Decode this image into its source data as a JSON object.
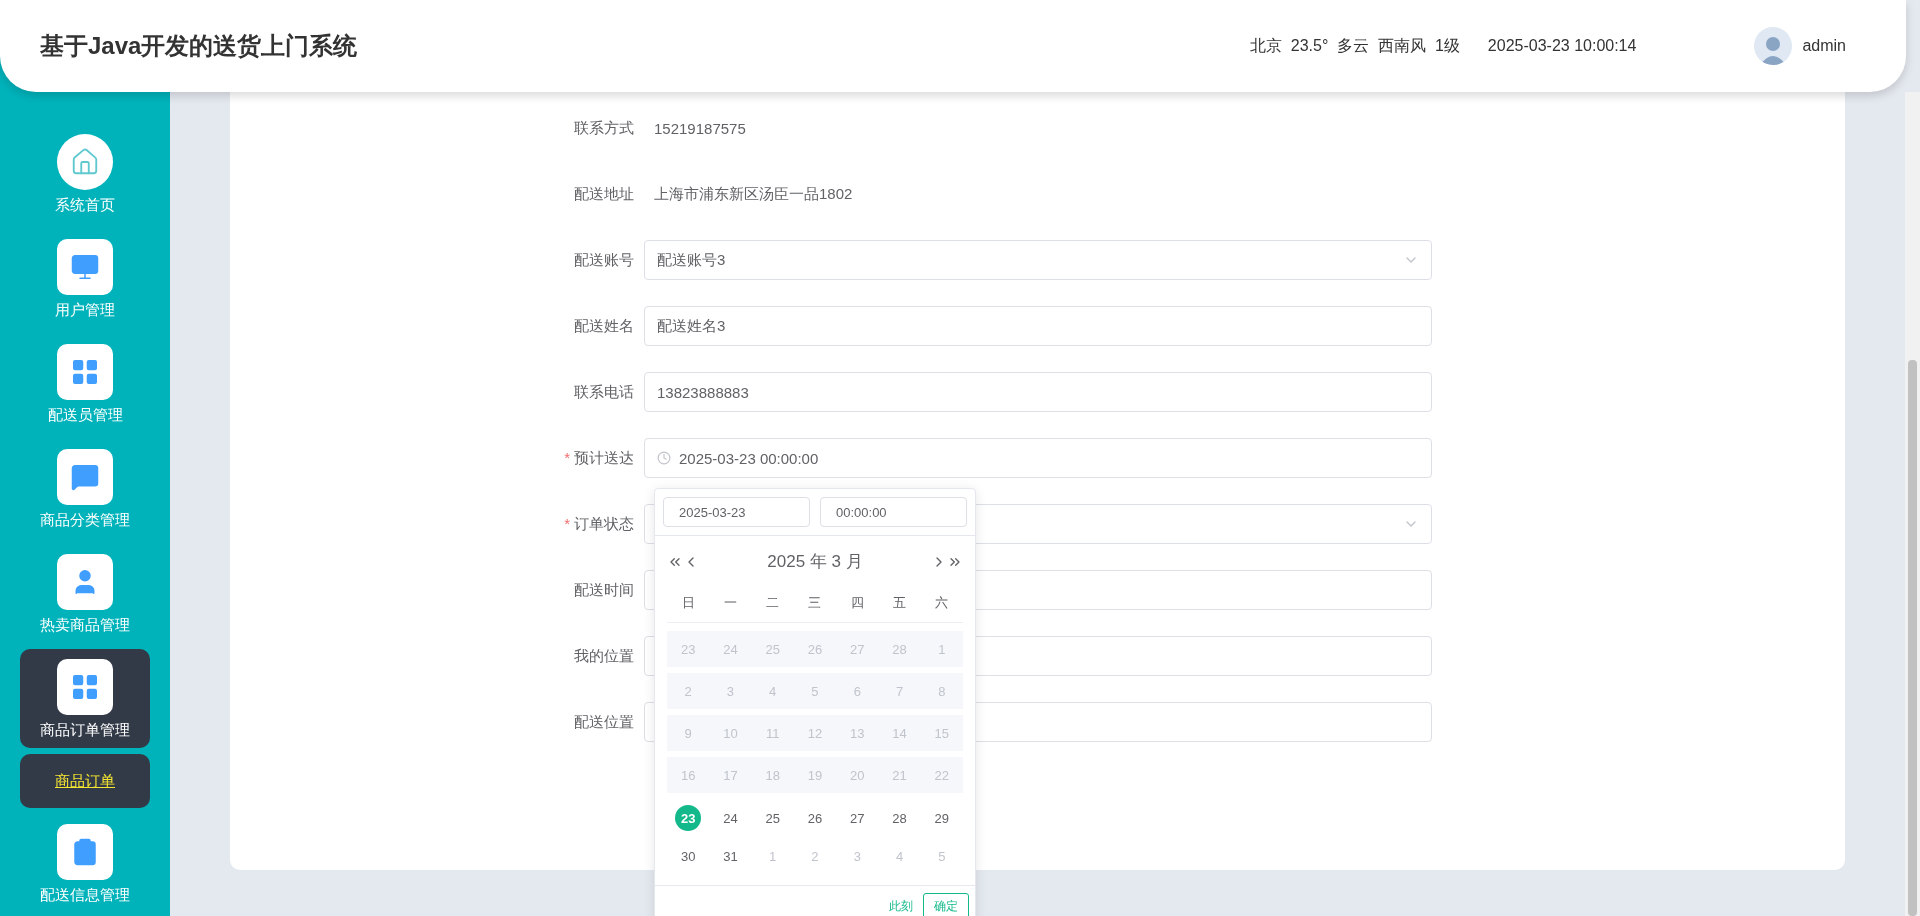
{
  "header": {
    "title": "基于Java开发的送货上门系统",
    "weather": "北京  23.5°  多云  西南风  1级",
    "time": "2025-03-23 10:00:14",
    "user": "admin"
  },
  "sidebar": {
    "items": [
      {
        "label": "系统首页",
        "selected": false
      },
      {
        "label": "用户管理",
        "selected": false
      },
      {
        "label": "配送员管理",
        "selected": false
      },
      {
        "label": "商品分类管理",
        "selected": false
      },
      {
        "label": "热卖商品管理",
        "selected": false
      },
      {
        "label": "商品订单管理",
        "selected": true,
        "children": [
          {
            "label": "商品订单",
            "selected": true
          }
        ]
      },
      {
        "label": "配送信息管理",
        "selected": false
      }
    ]
  },
  "form": {
    "fields": [
      {
        "label": "联系方式",
        "kind": "text",
        "value": "15219187575"
      },
      {
        "label": "配送地址",
        "kind": "text",
        "value": "上海市浦东新区汤臣一品1802"
      },
      {
        "label": "配送账号",
        "kind": "select",
        "value": "配送账号3"
      },
      {
        "label": "配送姓名",
        "kind": "input",
        "value": "配送姓名3"
      },
      {
        "label": "联系电话",
        "kind": "input",
        "value": "13823888883"
      },
      {
        "label": "预计送达",
        "required_mark": "*",
        "kind": "date",
        "value": "2025-03-23 00:00:00"
      },
      {
        "label": "订单状态",
        "required_mark": "*",
        "kind": "select"
      },
      {
        "label": "配送时间",
        "kind": "input"
      },
      {
        "label": "我的位置",
        "kind": "input"
      },
      {
        "label": "配送位置",
        "kind": "input"
      }
    ]
  },
  "date_picker": {
    "date_value": "2025-03-23",
    "time_value": "00:00:00",
    "title": "2025 年  3 月",
    "weekdays": [
      "日",
      "一",
      "二",
      "三",
      "四",
      "五",
      "六"
    ],
    "weeks": [
      [
        {
          "day": "23",
          "kind": "disabled",
          "selected": false
        },
        {
          "day": "24",
          "kind": "disabled",
          "selected": false
        },
        {
          "day": "25",
          "kind": "disabled",
          "selected": false
        },
        {
          "day": "26",
          "kind": "disabled",
          "selected": false
        },
        {
          "day": "27",
          "kind": "disabled",
          "selected": false
        },
        {
          "day": "28",
          "kind": "disabled",
          "selected": false
        },
        {
          "day": "1",
          "kind": "disabled",
          "selected": false
        }
      ],
      [
        {
          "day": "2",
          "kind": "disabled",
          "selected": false
        },
        {
          "day": "3",
          "kind": "disabled",
          "selected": false
        },
        {
          "day": "4",
          "kind": "disabled",
          "selected": false
        },
        {
          "day": "5",
          "kind": "disabled",
          "selected": false
        },
        {
          "day": "6",
          "kind": "disabled",
          "selected": false
        },
        {
          "day": "7",
          "kind": "disabled",
          "selected": false
        },
        {
          "day": "8",
          "kind": "disabled",
          "selected": false
        }
      ],
      [
        {
          "day": "9",
          "kind": "disabled",
          "selected": false
        },
        {
          "day": "10",
          "kind": "disabled",
          "selected": false
        },
        {
          "day": "11",
          "kind": "disabled",
          "selected": false
        },
        {
          "day": "12",
          "kind": "disabled",
          "selected": false
        },
        {
          "day": "13",
          "kind": "disabled",
          "selected": false
        },
        {
          "day": "14",
          "kind": "disabled",
          "selected": false
        },
        {
          "day": "15",
          "kind": "disabled",
          "selected": false
        }
      ],
      [
        {
          "day": "16",
          "kind": "disabled",
          "selected": false
        },
        {
          "day": "17",
          "kind": "disabled",
          "selected": false
        },
        {
          "day": "18",
          "kind": "disabled",
          "selected": false
        },
        {
          "day": "19",
          "kind": "disabled",
          "selected": false
        },
        {
          "day": "20",
          "kind": "disabled",
          "selected": false
        },
        {
          "day": "21",
          "kind": "disabled",
          "selected": false
        },
        {
          "day": "22",
          "kind": "disabled",
          "selected": false
        }
      ],
      [
        {
          "day": "23",
          "kind": "normal",
          "selected": true
        },
        {
          "day": "24",
          "kind": "normal",
          "selected": false
        },
        {
          "day": "25",
          "kind": "normal",
          "selected": false
        },
        {
          "day": "26",
          "kind": "normal",
          "selected": false
        },
        {
          "day": "27",
          "kind": "normal",
          "selected": false
        },
        {
          "day": "28",
          "kind": "normal",
          "selected": false
        },
        {
          "day": "29",
          "kind": "normal",
          "selected": false
        }
      ],
      [
        {
          "day": "30",
          "kind": "normal",
          "selected": false
        },
        {
          "day": "31",
          "kind": "normal",
          "selected": false
        },
        {
          "day": "1",
          "kind": "next",
          "selected": false
        },
        {
          "day": "2",
          "kind": "next",
          "selected": false
        },
        {
          "day": "3",
          "kind": "next",
          "selected": false
        },
        {
          "day": "4",
          "kind": "next",
          "selected": false
        },
        {
          "day": "5",
          "kind": "next",
          "selected": false
        }
      ]
    ],
    "now_link": "此刻",
    "confirm": "确定"
  }
}
